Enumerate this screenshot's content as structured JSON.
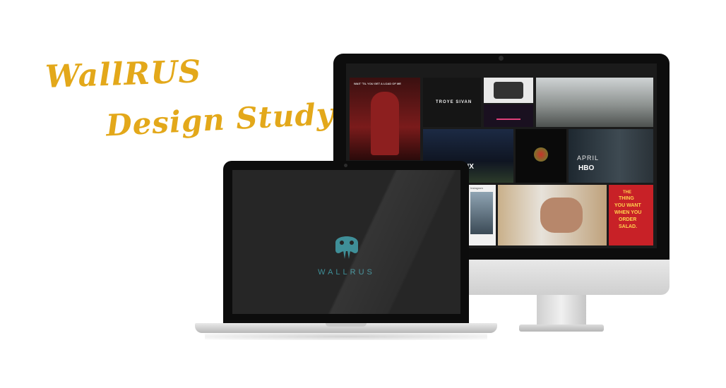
{
  "headline": {
    "line1": "WallRUS",
    "line2": "Design Study"
  },
  "colors": {
    "headline": "#e3a81a",
    "brand": "#3f8f98",
    "laptop_screen": "#262626",
    "bezel": "#0d0d0d"
  },
  "laptop": {
    "logo_icon": "walrus-icon",
    "brand_word": "WALLRUS"
  },
  "desktop_tiles": {
    "deadpool_caption": "WAIT 'TIL YOU GET A LOAD OF ME",
    "troye": "TROYE SIVAN",
    "fourth_tile": "NX",
    "april": "APRIL",
    "hbo": "HBO",
    "mcd_line1": "THE",
    "mcd_line2": "THING",
    "mcd_line3": "YOU WANT",
    "mcd_line4": "WHEN YOU",
    "mcd_line5": "ORDER",
    "mcd_line6": "SALAD.",
    "instagram": "Instagram"
  }
}
